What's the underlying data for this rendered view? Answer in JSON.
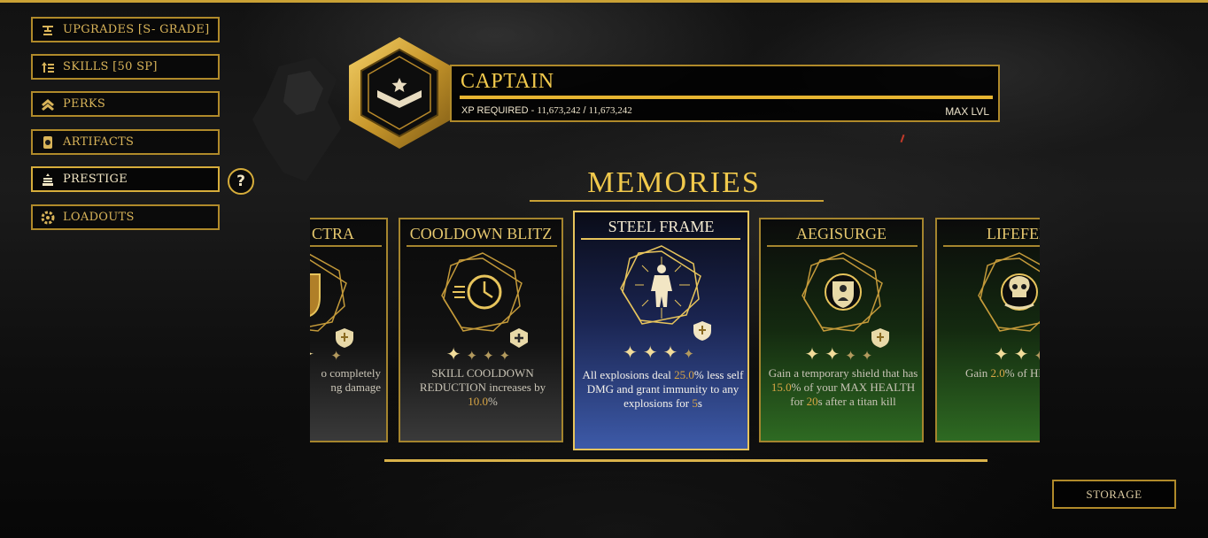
{
  "colors": {
    "accent_gold": "#e7b531",
    "selected_card_bg": "#3d5aa8",
    "green_card_bg": "#2e6a22",
    "highlight_value": "#d9a645"
  },
  "sidebar": {
    "items": [
      {
        "label": "UPGRADES [S- GRADE]",
        "icon": "anvil-icon",
        "active": false
      },
      {
        "label": "SKILLS [50 SP]",
        "icon": "skill-tree-icon",
        "active": false
      },
      {
        "label": "PERKS",
        "icon": "chevrons-up-icon",
        "active": false
      },
      {
        "label": "ARTIFACTS",
        "icon": "artifact-icon",
        "active": false
      },
      {
        "label": "PRESTIGE",
        "icon": "prestige-icon",
        "active": true
      },
      {
        "label": "LOADOUTS",
        "icon": "gear-loadout-icon",
        "active": false
      }
    ],
    "help_label": "?"
  },
  "rank": {
    "title": "CAPTAIN",
    "xp_label": "XP REQUIRED -",
    "xp_current": "11,673,242",
    "xp_separator": "/",
    "xp_required": "11,673,242",
    "xp_progress": 1.0,
    "level_status": "MAX LVL",
    "badge_icon": "captain-rank-icon"
  },
  "memories": {
    "heading": "MEMORIES",
    "cards": [
      {
        "title": "CTRA",
        "icon": "shield-fist-icon",
        "stars_filled": 2,
        "stars_total": 2,
        "desc_parts": [
          "o completely",
          "ng damage"
        ],
        "style": "dark"
      },
      {
        "title": "COOLDOWN BLITZ",
        "icon": "clock-speed-icon",
        "stars_filled": 1,
        "stars_total": 4,
        "desc_pre": "SKILL COOLDOWN REDUCTION increases by ",
        "desc_value": "10.0",
        "desc_post": "%",
        "style": "dark"
      },
      {
        "title": "STEEL FRAME",
        "icon": "armored-figure-icon",
        "stars_filled": 3,
        "stars_total": 4,
        "desc_a": "All explosions deal ",
        "desc_value_a": "25.0",
        "desc_b": "% less self DMG and grant immunity to any explosions for ",
        "desc_value_b": "5",
        "desc_c": "s",
        "style": "selected"
      },
      {
        "title": "AEGISURGE",
        "icon": "shield-surge-icon",
        "stars_filled": 2,
        "stars_total": 4,
        "desc_a": "Gain a temporary shield that has ",
        "desc_value_a": "15.0",
        "desc_b": "% of your MAX HEALTH for ",
        "desc_value_b": "20",
        "desc_c": "s after a titan kill",
        "style": "green"
      },
      {
        "title": "LIFEFEE",
        "icon": "skull-hand-icon",
        "stars_filled": 2,
        "stars_total": 3,
        "desc_a": "Gain ",
        "desc_value_a": "2.0",
        "desc_b": "% of HEALTH back pe",
        "style": "green"
      }
    ]
  },
  "storage_label": "STORAGE"
}
